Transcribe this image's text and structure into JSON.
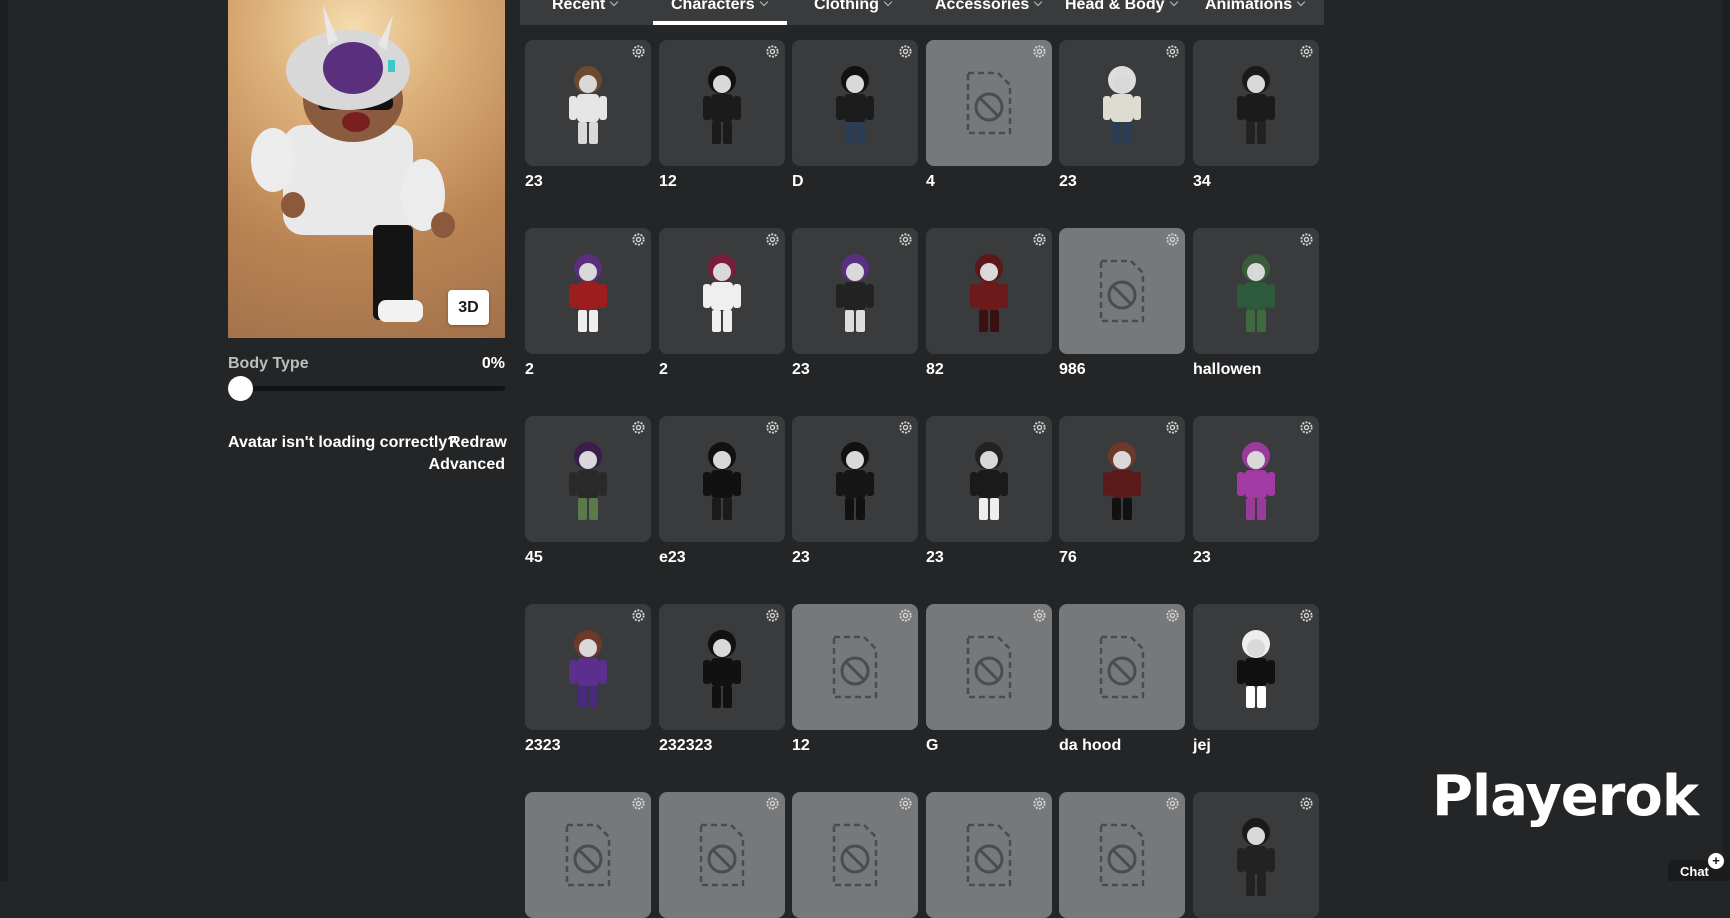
{
  "tabs": [
    {
      "label": "Recent",
      "active": false
    },
    {
      "label": "Characters",
      "active": true
    },
    {
      "label": "Clothing",
      "active": false
    },
    {
      "label": "Accessories",
      "active": false
    },
    {
      "label": "Head & Body",
      "active": false
    },
    {
      "label": "Animations",
      "active": false
    }
  ],
  "avatar": {
    "view_button": "3D",
    "body_type_label": "Body Type",
    "body_type_value": "0%",
    "body_type_fraction": 0,
    "loading_text": "Avatar isn't loading correctly?",
    "redraw_label": "Redraw",
    "advanced_label": "Advanced"
  },
  "characters": [
    {
      "name": "23",
      "thumb": "character"
    },
    {
      "name": "12",
      "thumb": "character"
    },
    {
      "name": "D",
      "thumb": "character"
    },
    {
      "name": "4",
      "thumb": "unavailable"
    },
    {
      "name": "23",
      "thumb": "character"
    },
    {
      "name": "34",
      "thumb": "character"
    },
    {
      "name": "2",
      "thumb": "character"
    },
    {
      "name": "2",
      "thumb": "character"
    },
    {
      "name": "23",
      "thumb": "character"
    },
    {
      "name": "82",
      "thumb": "character"
    },
    {
      "name": "986",
      "thumb": "unavailable"
    },
    {
      "name": "hallowen",
      "thumb": "character"
    },
    {
      "name": "45",
      "thumb": "character"
    },
    {
      "name": "e23",
      "thumb": "character"
    },
    {
      "name": "23",
      "thumb": "character"
    },
    {
      "name": "23",
      "thumb": "character"
    },
    {
      "name": "76",
      "thumb": "character"
    },
    {
      "name": "23",
      "thumb": "character"
    },
    {
      "name": "2323",
      "thumb": "character"
    },
    {
      "name": "232323",
      "thumb": "character"
    },
    {
      "name": "12",
      "thumb": "unavailable"
    },
    {
      "name": "G",
      "thumb": "unavailable"
    },
    {
      "name": "da hood",
      "thumb": "unavailable"
    },
    {
      "name": "jej",
      "thumb": "character"
    },
    {
      "name": "",
      "thumb": "unavailable"
    },
    {
      "name": "",
      "thumb": "unavailable"
    },
    {
      "name": "",
      "thumb": "unavailable"
    },
    {
      "name": "",
      "thumb": "unavailable"
    },
    {
      "name": "",
      "thumb": "unavailable"
    },
    {
      "name": "",
      "thumb": "character"
    }
  ],
  "watermark": "Playerok",
  "chat": {
    "label": "Chat",
    "badge": "+"
  },
  "colors": {
    "background": "#232527",
    "card": "#393b3d",
    "card_empty": "#76787a",
    "tabbar": "#393b3d"
  },
  "icons": {
    "card_settings": "gear-icon",
    "unavailable": "no-image-icon",
    "tab_dropdown": "chevron-down-icon"
  }
}
